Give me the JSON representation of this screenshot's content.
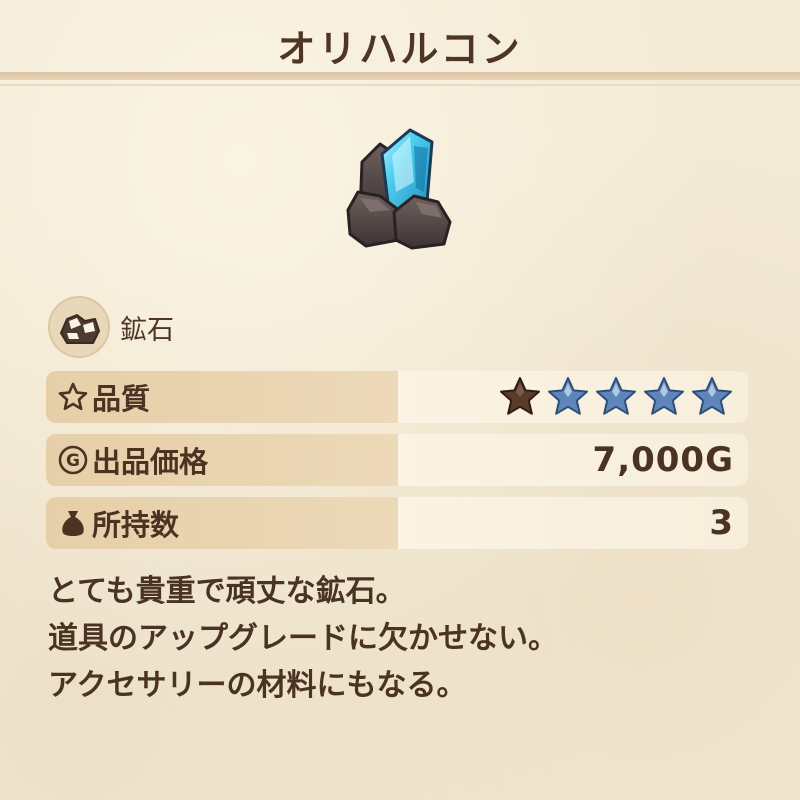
{
  "item": {
    "title": "オリハルコン",
    "category_label": "鉱石",
    "category_icon": "ore-rock-icon",
    "art_icon": "crystal-ore-icon"
  },
  "stats": {
    "quality": {
      "icon": "star-outline-icon",
      "label": "品質",
      "rating": 1,
      "max": 5,
      "filled_color": "#5a3a2a",
      "empty_color": "#5f86b8"
    },
    "price": {
      "icon": "gold-coin-icon",
      "label": "出品価格",
      "value": "7,000G"
    },
    "owned": {
      "icon": "money-bag-icon",
      "label": "所持数",
      "value": "3"
    }
  },
  "description": {
    "lines": [
      "とても貴重で頑丈な鉱石。",
      "道具のアップグレードに欠かせない。",
      "アクセサリーの材料にもなる。"
    ]
  },
  "colors": {
    "background": "#f3ead6",
    "text": "#4a3322",
    "label_panel": "#e6cfa8",
    "value_panel": "#fbf3e3",
    "crystal": "#3fbfe6"
  }
}
